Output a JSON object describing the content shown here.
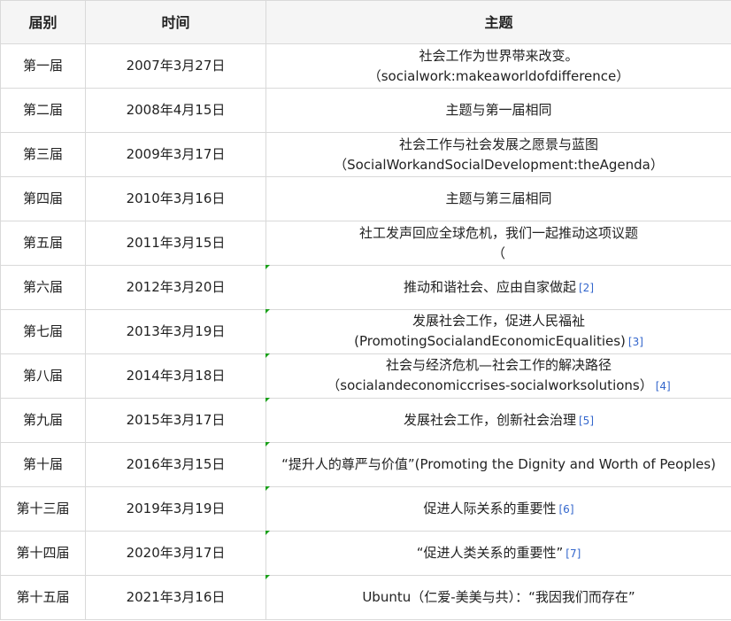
{
  "table": {
    "headers": {
      "session": "届别",
      "date": "时间",
      "topic": "主题"
    },
    "rows": [
      {
        "session": "第一届",
        "date": "2007年3月27日",
        "topic_line1": "社会工作为世界带来改变。",
        "topic_line2": "（socialwork:makeaworldofdifference）",
        "ref": ""
      },
      {
        "session": "第二届",
        "date": "2008年4月15日",
        "topic_line1": "主题与第一届相同",
        "topic_line2": "",
        "ref": ""
      },
      {
        "session": "第三届",
        "date": "2009年3月17日",
        "topic_line1": "社会工作与社会发展之愿景与蓝图",
        "topic_line2": "（SocialWorkandSocialDevelopment:theAgenda）",
        "ref": ""
      },
      {
        "session": "第四届",
        "date": "2010年3月16日",
        "topic_line1": "主题与第三届相同",
        "topic_line2": "",
        "ref": ""
      },
      {
        "session": "第五届",
        "date": "2011年3月15日",
        "topic_line1": "社工发声回应全球危机，我们一起推动这项议题",
        "topic_line2": "（",
        "ref": ""
      },
      {
        "session": "第六届",
        "date": "2012年3月20日",
        "topic_line1": "推动和谐社会、应由自家做起",
        "topic_line2": "",
        "ref": "[2]"
      },
      {
        "session": "第七届",
        "date": "2013年3月19日",
        "topic_line1": "发展社会工作，促进人民福祉",
        "topic_line2": "(PromotingSocialandEconomicEqualities)",
        "ref": "[3]"
      },
      {
        "session": "第八届",
        "date": "2014年3月18日",
        "topic_line1": "社会与经济危机—社会工作的解决路径",
        "topic_line2": "（socialandeconomiccrises-socialworksolutions）",
        "ref": "[4]"
      },
      {
        "session": "第九届",
        "date": "2015年3月17日",
        "topic_line1": "发展社会工作，创新社会治理",
        "topic_line2": "",
        "ref": "[5]"
      },
      {
        "session": "第十届",
        "date": "2016年3月15日",
        "topic_line1": "“提升人的尊严与价值”(Promoting the Dignity and Worth of Peoples)",
        "topic_line2": "",
        "ref": ""
      },
      {
        "session": "第十三届",
        "date": "2019年3月19日",
        "topic_line1": "促进人际关系的重要性",
        "topic_line2": "",
        "ref": "[6]"
      },
      {
        "session": "第十四届",
        "date": "2020年3月17日",
        "topic_line1": "“促进人类关系的重要性”",
        "topic_line2": "",
        "ref": "[7]"
      },
      {
        "session": "第十五届",
        "date": "2021年3月16日",
        "topic_line1": "Ubuntu（仁爱-美美与共）：“我因我们而存在”",
        "topic_line2": "",
        "ref": ""
      }
    ]
  },
  "colors": {
    "header_bg": "#f5f5f5",
    "border": "#d9d9d9",
    "ref_link": "#3366cc",
    "edit_mark": "#1aa01a"
  }
}
